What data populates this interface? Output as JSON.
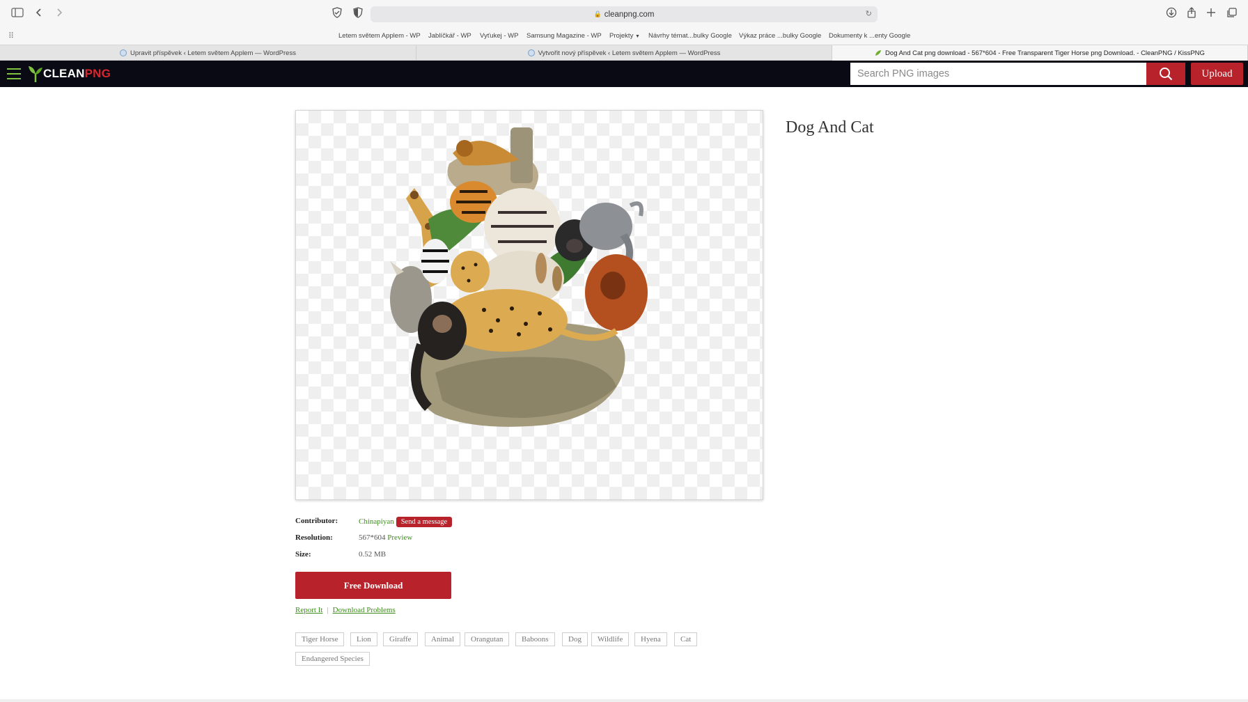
{
  "browser": {
    "url": "cleanpng.com",
    "favorites": [
      "Letem světem Applem - WP",
      "Jablíčkář - WP",
      "Vyťukej - WP",
      "Samsung Magazine - WP",
      "Projekty",
      "Návrhy témat...bulky Google",
      "Výkaz práce ...bulky Google",
      "Dokumenty k ...enty Google"
    ],
    "tabs": [
      {
        "label": "Upravit příspěvek ‹ Letem světem Applem — WordPress",
        "active": false
      },
      {
        "label": "Vytvořit nový příspěvek ‹ Letem světem Applem — WordPress",
        "active": false
      },
      {
        "label": "Dog And Cat png download - 567*604 - Free Transparent Tiger Horse png Download. - CleanPNG / KissPNG",
        "active": true
      }
    ]
  },
  "header": {
    "logo_clean": "CLEAN",
    "logo_png": "PNG",
    "search_placeholder": "Search PNG images",
    "upload_label": "Upload",
    "accent_color": "#b8232b",
    "brand_green": "#7fc241"
  },
  "content": {
    "title": "Dog And Cat",
    "contributor_label": "Contributor:",
    "contributor_name": "Chinapiyan",
    "send_message_label": "Send a message",
    "resolution_label": "Resolution:",
    "resolution_value": "567*604",
    "preview_label": "Preview",
    "size_label": "Size:",
    "size_value": "0.52 MB",
    "download_label": "Free Download",
    "report_label": "Report It",
    "separator": "|",
    "problems_label": "Download Problems",
    "tags": [
      "Tiger Horse",
      "Lion",
      "Giraffe",
      "Animal",
      "Orangutan",
      "Baboons",
      "Dog",
      "Wildlife",
      "Hyena",
      "Cat",
      "Endangered Species"
    ]
  }
}
